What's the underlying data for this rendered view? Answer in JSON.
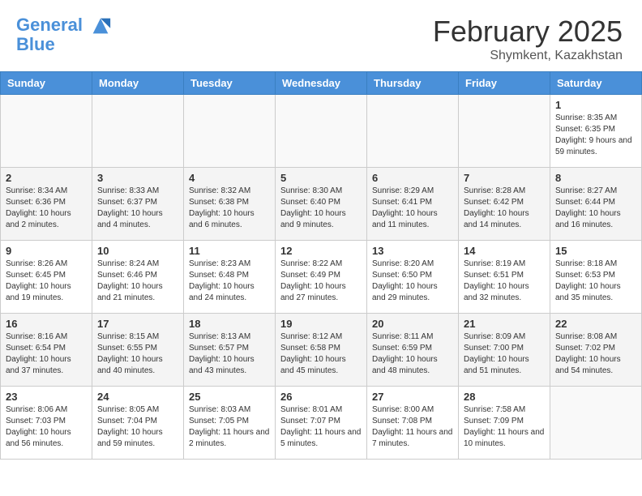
{
  "header": {
    "logo_line1": "General",
    "logo_line2": "Blue",
    "month": "February 2025",
    "location": "Shymkent, Kazakhstan"
  },
  "weekdays": [
    "Sunday",
    "Monday",
    "Tuesday",
    "Wednesday",
    "Thursday",
    "Friday",
    "Saturday"
  ],
  "weeks": [
    [
      {
        "day": "",
        "info": ""
      },
      {
        "day": "",
        "info": ""
      },
      {
        "day": "",
        "info": ""
      },
      {
        "day": "",
        "info": ""
      },
      {
        "day": "",
        "info": ""
      },
      {
        "day": "",
        "info": ""
      },
      {
        "day": "1",
        "info": "Sunrise: 8:35 AM\nSunset: 6:35 PM\nDaylight: 9 hours and 59 minutes."
      }
    ],
    [
      {
        "day": "2",
        "info": "Sunrise: 8:34 AM\nSunset: 6:36 PM\nDaylight: 10 hours and 2 minutes."
      },
      {
        "day": "3",
        "info": "Sunrise: 8:33 AM\nSunset: 6:37 PM\nDaylight: 10 hours and 4 minutes."
      },
      {
        "day": "4",
        "info": "Sunrise: 8:32 AM\nSunset: 6:38 PM\nDaylight: 10 hours and 6 minutes."
      },
      {
        "day": "5",
        "info": "Sunrise: 8:30 AM\nSunset: 6:40 PM\nDaylight: 10 hours and 9 minutes."
      },
      {
        "day": "6",
        "info": "Sunrise: 8:29 AM\nSunset: 6:41 PM\nDaylight: 10 hours and 11 minutes."
      },
      {
        "day": "7",
        "info": "Sunrise: 8:28 AM\nSunset: 6:42 PM\nDaylight: 10 hours and 14 minutes."
      },
      {
        "day": "8",
        "info": "Sunrise: 8:27 AM\nSunset: 6:44 PM\nDaylight: 10 hours and 16 minutes."
      }
    ],
    [
      {
        "day": "9",
        "info": "Sunrise: 8:26 AM\nSunset: 6:45 PM\nDaylight: 10 hours and 19 minutes."
      },
      {
        "day": "10",
        "info": "Sunrise: 8:24 AM\nSunset: 6:46 PM\nDaylight: 10 hours and 21 minutes."
      },
      {
        "day": "11",
        "info": "Sunrise: 8:23 AM\nSunset: 6:48 PM\nDaylight: 10 hours and 24 minutes."
      },
      {
        "day": "12",
        "info": "Sunrise: 8:22 AM\nSunset: 6:49 PM\nDaylight: 10 hours and 27 minutes."
      },
      {
        "day": "13",
        "info": "Sunrise: 8:20 AM\nSunset: 6:50 PM\nDaylight: 10 hours and 29 minutes."
      },
      {
        "day": "14",
        "info": "Sunrise: 8:19 AM\nSunset: 6:51 PM\nDaylight: 10 hours and 32 minutes."
      },
      {
        "day": "15",
        "info": "Sunrise: 8:18 AM\nSunset: 6:53 PM\nDaylight: 10 hours and 35 minutes."
      }
    ],
    [
      {
        "day": "16",
        "info": "Sunrise: 8:16 AM\nSunset: 6:54 PM\nDaylight: 10 hours and 37 minutes."
      },
      {
        "day": "17",
        "info": "Sunrise: 8:15 AM\nSunset: 6:55 PM\nDaylight: 10 hours and 40 minutes."
      },
      {
        "day": "18",
        "info": "Sunrise: 8:13 AM\nSunset: 6:57 PM\nDaylight: 10 hours and 43 minutes."
      },
      {
        "day": "19",
        "info": "Sunrise: 8:12 AM\nSunset: 6:58 PM\nDaylight: 10 hours and 45 minutes."
      },
      {
        "day": "20",
        "info": "Sunrise: 8:11 AM\nSunset: 6:59 PM\nDaylight: 10 hours and 48 minutes."
      },
      {
        "day": "21",
        "info": "Sunrise: 8:09 AM\nSunset: 7:00 PM\nDaylight: 10 hours and 51 minutes."
      },
      {
        "day": "22",
        "info": "Sunrise: 8:08 AM\nSunset: 7:02 PM\nDaylight: 10 hours and 54 minutes."
      }
    ],
    [
      {
        "day": "23",
        "info": "Sunrise: 8:06 AM\nSunset: 7:03 PM\nDaylight: 10 hours and 56 minutes."
      },
      {
        "day": "24",
        "info": "Sunrise: 8:05 AM\nSunset: 7:04 PM\nDaylight: 10 hours and 59 minutes."
      },
      {
        "day": "25",
        "info": "Sunrise: 8:03 AM\nSunset: 7:05 PM\nDaylight: 11 hours and 2 minutes."
      },
      {
        "day": "26",
        "info": "Sunrise: 8:01 AM\nSunset: 7:07 PM\nDaylight: 11 hours and 5 minutes."
      },
      {
        "day": "27",
        "info": "Sunrise: 8:00 AM\nSunset: 7:08 PM\nDaylight: 11 hours and 7 minutes."
      },
      {
        "day": "28",
        "info": "Sunrise: 7:58 AM\nSunset: 7:09 PM\nDaylight: 11 hours and 10 minutes."
      },
      {
        "day": "",
        "info": ""
      }
    ]
  ]
}
